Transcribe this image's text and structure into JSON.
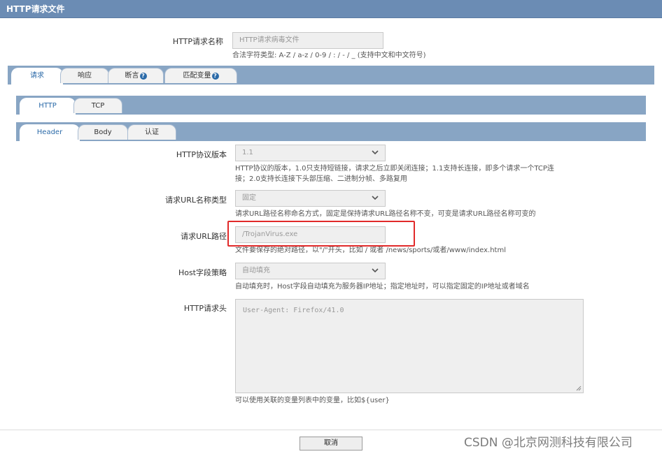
{
  "window": {
    "title": "HTTP请求文件"
  },
  "name_field": {
    "label": "HTTP请求名称",
    "placeholder": "HTTP请求病毒文件",
    "hint": "合法字符类型: A-Z / a-z / 0-9 / : / - / _ (支持中文和中文符号)"
  },
  "main_tabs": [
    {
      "label": "请求",
      "active": true,
      "help": false
    },
    {
      "label": "响应",
      "active": false,
      "help": false
    },
    {
      "label": "断言",
      "active": false,
      "help": true
    },
    {
      "label": "匹配变量",
      "active": false,
      "help": true
    }
  ],
  "protocol_tabs": [
    {
      "label": "HTTP",
      "active": true
    },
    {
      "label": "TCP",
      "active": false
    }
  ],
  "http_tabs": [
    {
      "label": "Header",
      "active": true
    },
    {
      "label": "Body",
      "active": false
    },
    {
      "label": "认证",
      "active": false
    }
  ],
  "help_glyph": "?",
  "form": {
    "protocol_version": {
      "label": "HTTP协议版本",
      "value": "1.1",
      "hint_line1": "HTTP协议的版本，1.0只支持短链接，请求之后立即关闭连接；1.1支持长连接，即多个请求一个TCP连",
      "hint_line2": "接；2.0支持长连接下头部压缩、二进制分帧、多路复用"
    },
    "url_name_type": {
      "label": "请求URL名称类型",
      "value": "固定",
      "hint": "请求URL路径名称命名方式，固定是保持请求URL路径名称不变，可变是请求URL路径名称可变的"
    },
    "url_path": {
      "label": "请求URL路径",
      "placeholder": "/TrojanVirus.exe",
      "hint": "文件要保存的绝对路径，以\"/\"开头，比如 / 或者 /news/sports/或者/www/index.html"
    },
    "host_policy": {
      "label": "Host字段策略",
      "value": "自动填充",
      "hint": "自动填充时，Host字段自动填充为服务器IP地址；指定地址时，可以指定固定的IP地址或者域名"
    },
    "headers": {
      "label": "HTTP请求头",
      "placeholder": "User-Agent: Firefox/41.0",
      "hint": "可以使用关联的变量列表中的变量，比如${user}"
    }
  },
  "footer": {
    "cancel_label": "取消"
  },
  "watermark": "CSDN @北京网测科技有限公司",
  "colors": {
    "title_bar": "#6b8cb4",
    "tab_bar": "#88a5c4",
    "active_tab_text": "#2b6aa8",
    "highlight": "#e12a2a"
  }
}
